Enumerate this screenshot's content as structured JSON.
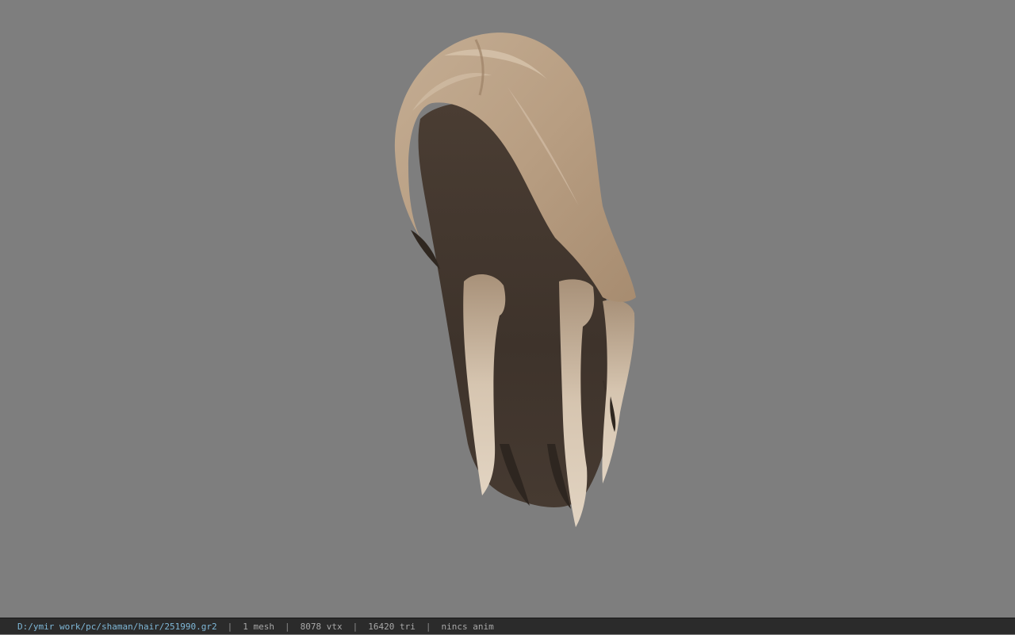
{
  "viewer": {
    "background_color": "#7e7e7e",
    "model_subject": "long-hair mesh"
  },
  "statusbar": {
    "file_path": "D:/ymir work/pc/shaman/hair/251990.gr2",
    "separator": "|",
    "mesh_count": "1 mesh",
    "vertex_count": "8078 vtx",
    "triangle_count": "16420 tri",
    "anim_status": "nincs anim",
    "path_color": "#7fb8d8"
  }
}
